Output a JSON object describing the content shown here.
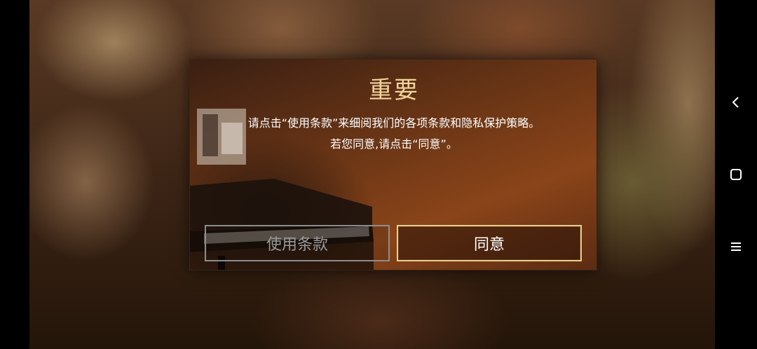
{
  "dialog": {
    "title": "重要",
    "message_line1": "请点击“使用条款”来细阅我们的各项条款和隐私保护策略。",
    "message_line2": "若您同意,请点击“同意”。",
    "terms_button": "使用条款",
    "agree_button": "同意"
  },
  "nav_bar": {
    "icons": [
      "back-icon",
      "home-icon",
      "menu-icon"
    ]
  },
  "colors": {
    "title": "#f3d49b",
    "agree_border": "#e9cf8d",
    "terms_border": "#8d8d8d"
  }
}
